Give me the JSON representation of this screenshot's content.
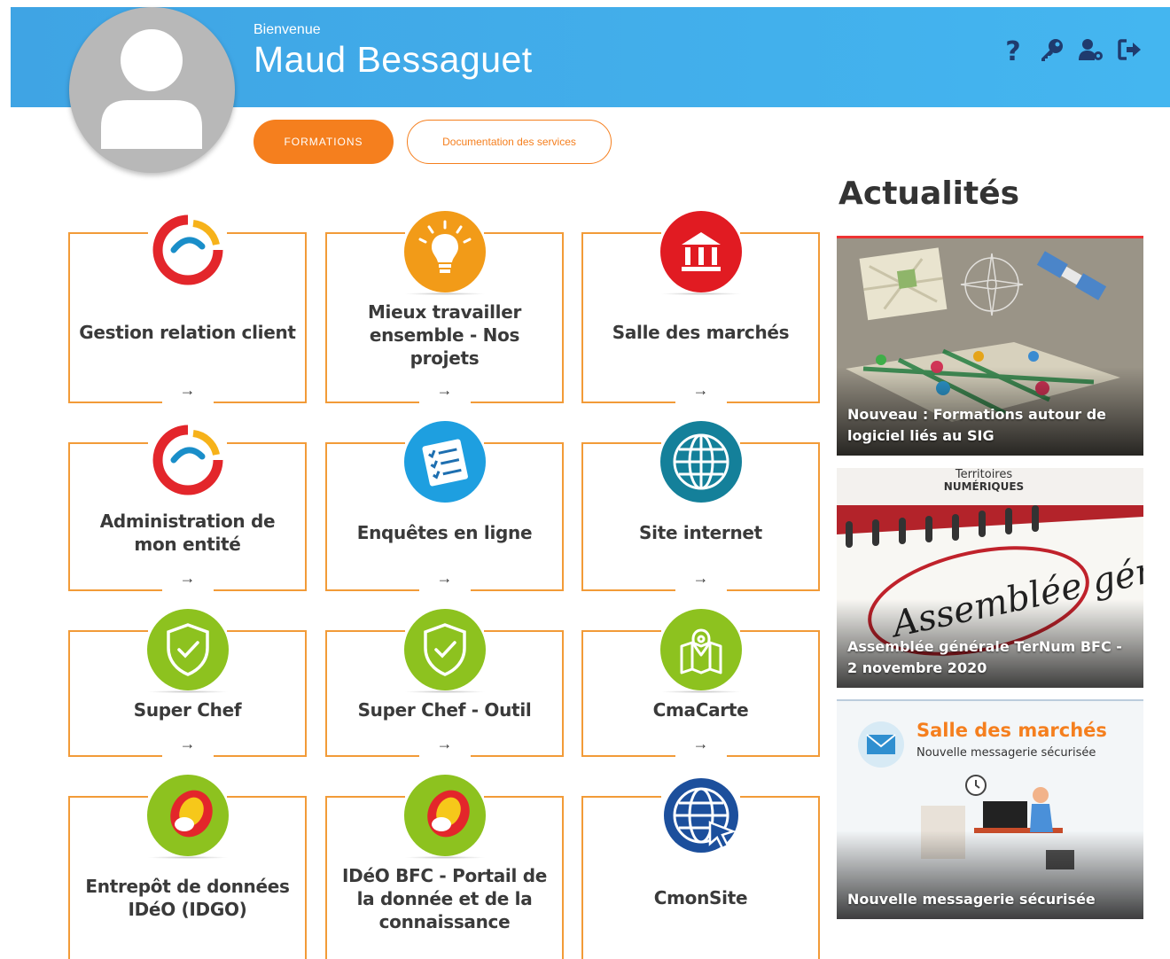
{
  "header": {
    "welcome": "Bienvenue",
    "username": "Maud Bessaguet",
    "icons": [
      "help-icon",
      "key-icon",
      "user-settings-icon",
      "logout-icon"
    ]
  },
  "buttons": {
    "formations": "FORMATIONS",
    "documentation": "Documentation des services"
  },
  "tiles": [
    {
      "title": "Gestion relation client",
      "icon": "crm-icon",
      "color": "#e3262b"
    },
    {
      "title": "Mieux travailler ensemble - Nos projets",
      "icon": "lightbulb-icon",
      "color": "#f29b18"
    },
    {
      "title": "Salle des marchés",
      "icon": "bank-icon",
      "color": "#e11b22"
    },
    {
      "title": "Administration de mon entité",
      "icon": "crm-icon",
      "color": "#e3262b"
    },
    {
      "title": "Enquêtes en ligne",
      "icon": "survey-icon",
      "color": "#1e9fe0"
    },
    {
      "title": "Site internet",
      "icon": "globe-icon",
      "color": "#14809a"
    },
    {
      "title": "Super Chef",
      "icon": "shield-check-icon",
      "color": "#8dc21f"
    },
    {
      "title": "Super Chef - Outil",
      "icon": "shield-check-icon",
      "color": "#8dc21f"
    },
    {
      "title": "CmaCarte",
      "icon": "map-icon",
      "color": "#8dc21f"
    },
    {
      "title": "Entrepôt de données IDéO (IDGO)",
      "icon": "ideo-icon",
      "color": "#8dc21f"
    },
    {
      "title": "IDéO BFC - Portail de la donnée et de la connaissance",
      "icon": "ideo-icon",
      "color": "#8dc21f"
    },
    {
      "title": "CmonSite",
      "icon": "web-cursor-icon",
      "color": "#1c4f9c"
    }
  ],
  "arrow": "→",
  "news": {
    "heading": "Actualités",
    "items": [
      {
        "caption": "Nouveau : Formations autour de logiciel liés au SIG"
      },
      {
        "caption": "Assemblée générale TerNum BFC - 2 novembre 2020",
        "brand_top": "Territoires",
        "brand_bottom": "NUMÉRIQUES",
        "handwriting": "Assemblée générale"
      },
      {
        "caption": "Nouvelle messagerie sécurisée",
        "title": "Salle des marchés",
        "subtitle": "Nouvelle messagerie sécurisée"
      }
    ]
  },
  "colors": {
    "banner": "#44b6f0",
    "accent": "#f57f1e",
    "tile_border": "#f29b38"
  }
}
